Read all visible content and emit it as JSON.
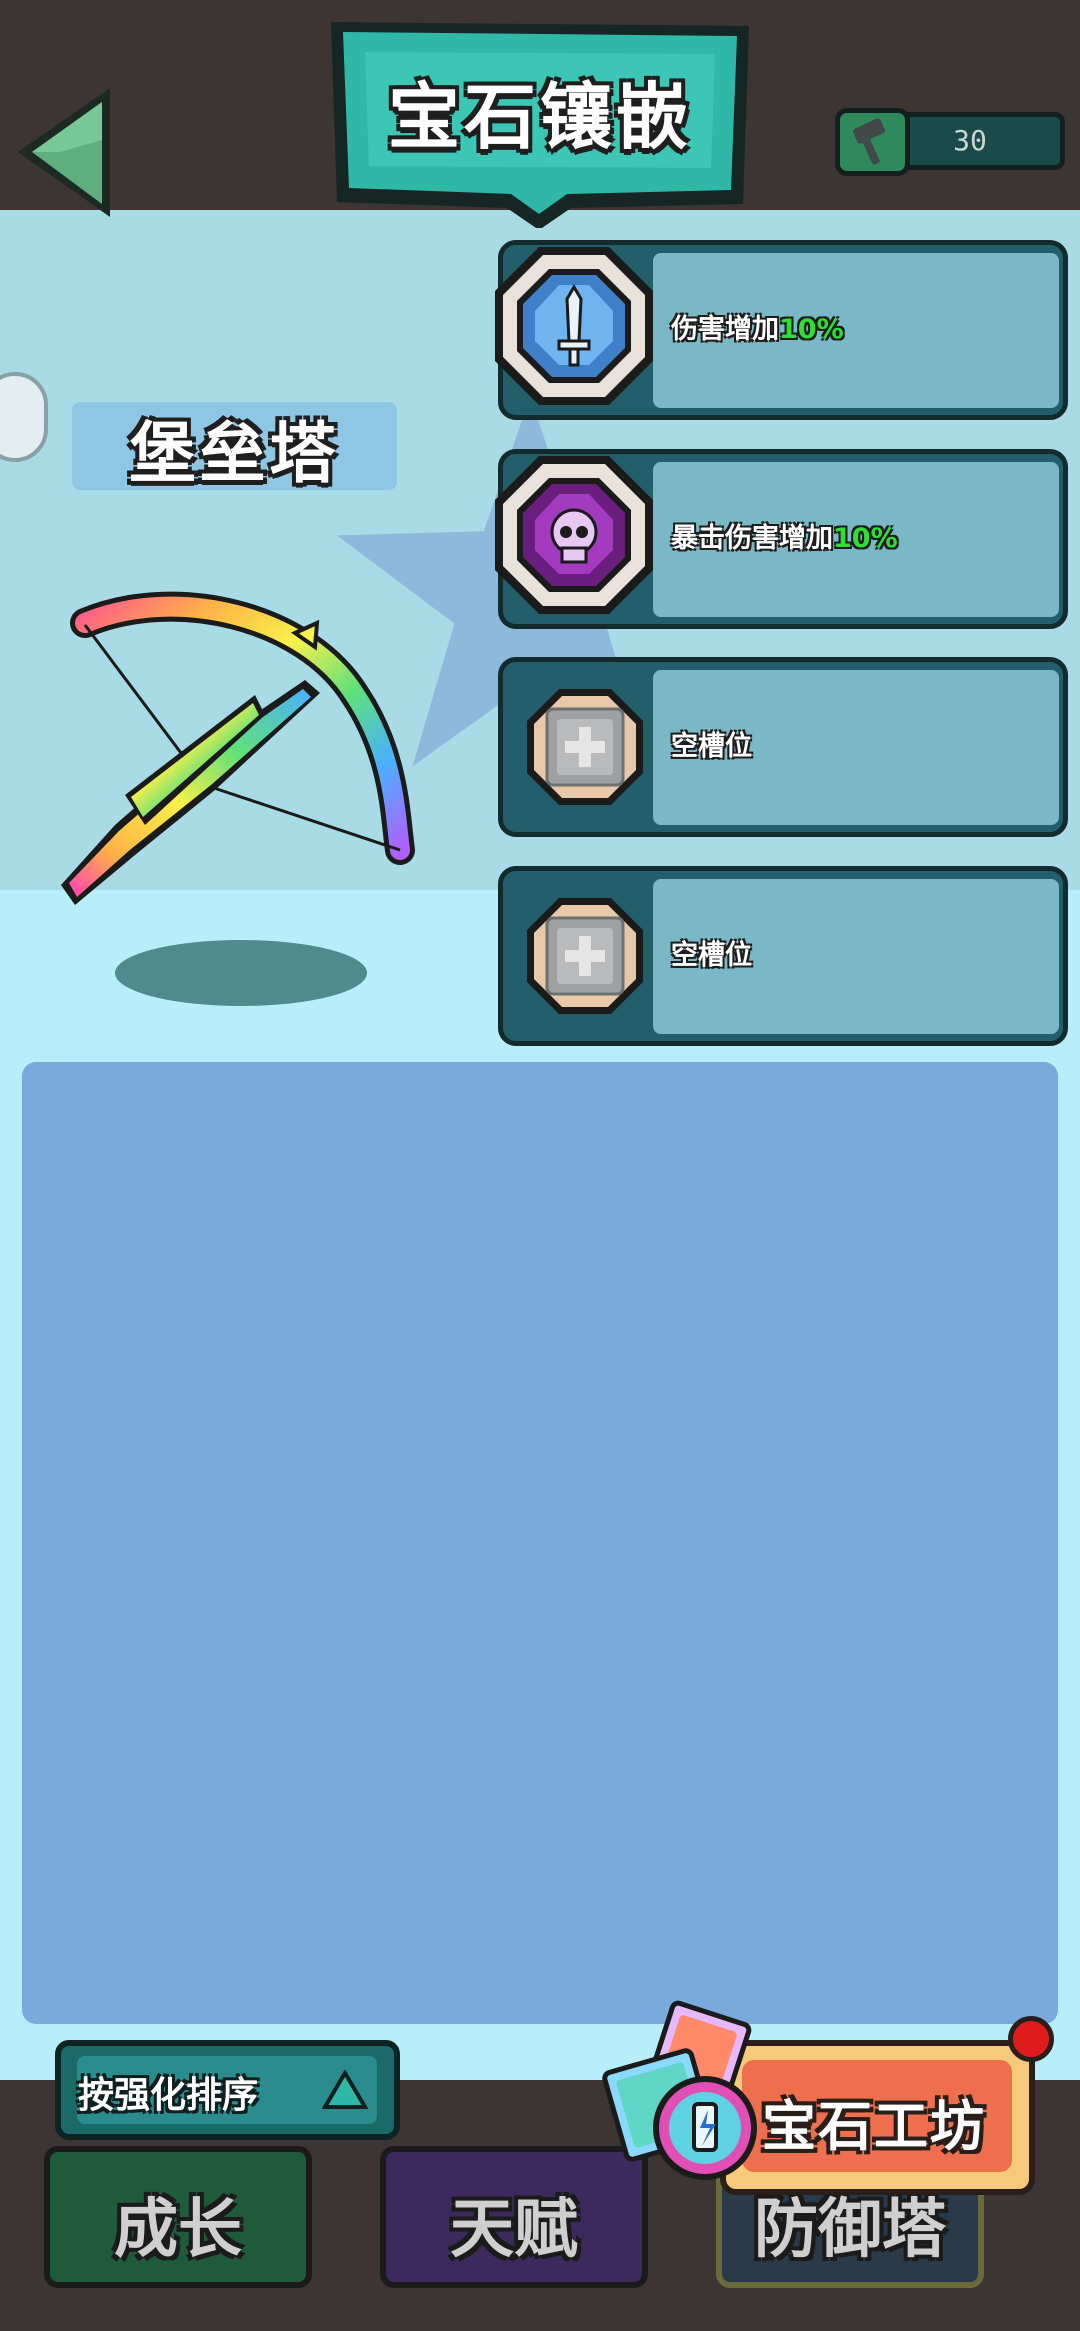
{
  "header": {
    "title": "宝石镶嵌",
    "back_icon": "back-arrow-icon",
    "currency": {
      "icon": "hammer-icon",
      "value": "30"
    }
  },
  "tower": {
    "name": "堡垒塔",
    "image": "rainbow-crossbow"
  },
  "slots": [
    {
      "label": "伤害增加",
      "value": "10%",
      "gem_icon": "blue-sword-gem-icon"
    },
    {
      "label": "暴击伤害增加",
      "value": "10%",
      "gem_icon": "purple-skull-gem-icon"
    },
    {
      "label": "空槽位",
      "value": "",
      "gem_icon": "plus-icon"
    },
    {
      "label": "空槽位",
      "value": "",
      "gem_icon": "plus-icon"
    }
  ],
  "sort_button": {
    "label": "按强化排序"
  },
  "workshop_button": {
    "label": "宝石工坊"
  },
  "tabs": [
    {
      "label": "成长",
      "color": "#1f5a3a"
    },
    {
      "label": "天赋",
      "color": "#3d2a5c"
    },
    {
      "label": "防御塔",
      "color": "#2a3a4a"
    }
  ],
  "colors": {
    "accent_teal": "#2fb8a8",
    "percent_green": "#2ede35",
    "panel_blue": "#7aaadc"
  }
}
